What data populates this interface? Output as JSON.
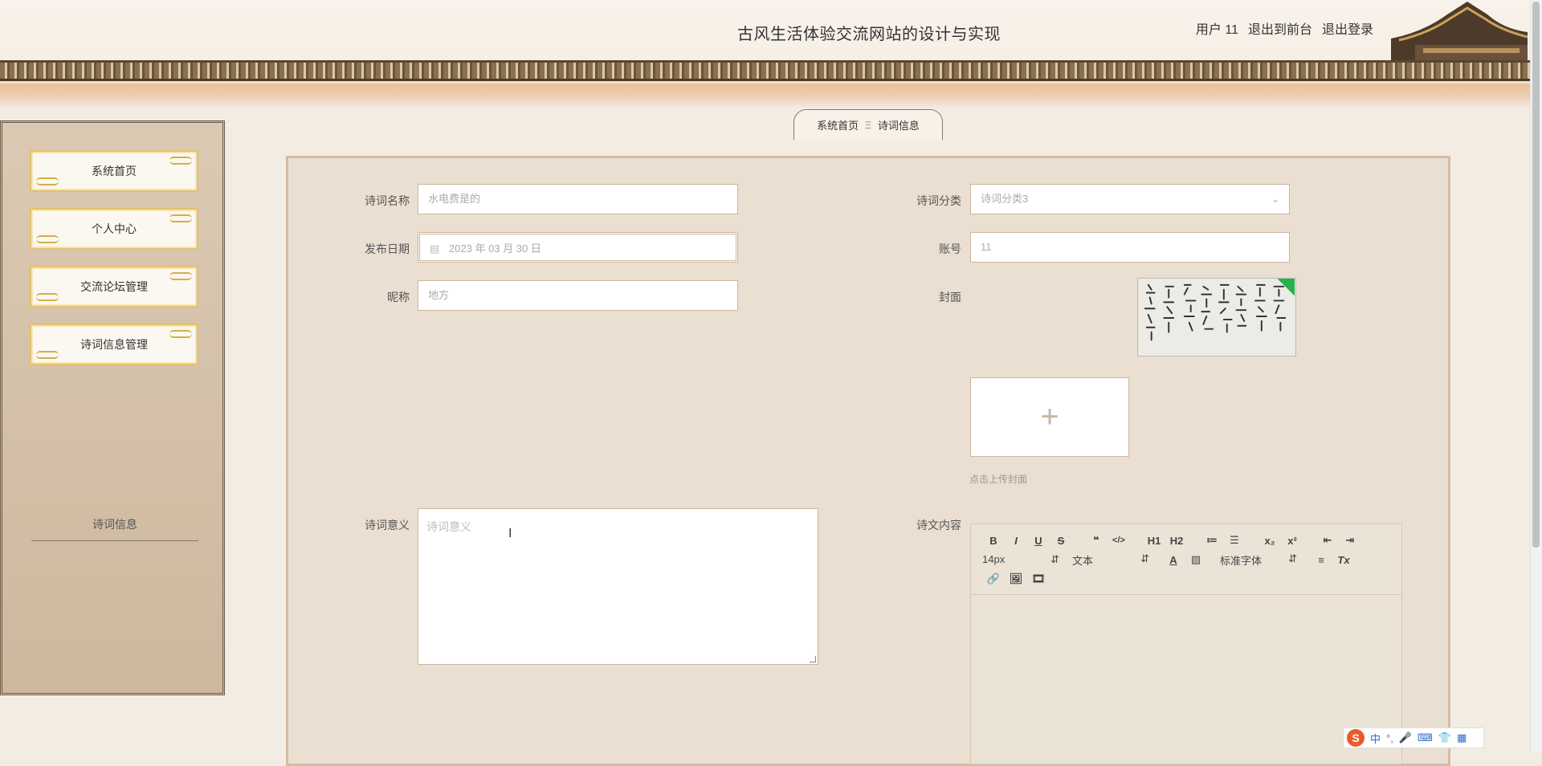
{
  "header": {
    "title": "古风生活体验交流网站的设计与实现",
    "user_label": "用户 11",
    "front_link": "退出到前台",
    "logout_link": "退出登录"
  },
  "sidebar": {
    "items": [
      {
        "label": "系统首页"
      },
      {
        "label": "个人中心"
      },
      {
        "label": "交流论坛管理"
      },
      {
        "label": "诗词信息管理"
      }
    ],
    "sub_item": "诗词信息"
  },
  "breadcrumb": {
    "home": "系统首页",
    "separator": "Ξ",
    "current": "诗词信息"
  },
  "form": {
    "poem_name": {
      "label": "诗词名称",
      "value": "水电费是的"
    },
    "category": {
      "label": "诗词分类",
      "value": "诗词分类3"
    },
    "publish_date": {
      "label": "发布日期",
      "value": "2023 年 03 月 30 日"
    },
    "account": {
      "label": "账号",
      "value": "11"
    },
    "nickname": {
      "label": "昵称",
      "value": "地方"
    },
    "cover": {
      "label": "封面",
      "upload_hint": "点击上传封面",
      "upload_symbol": "+"
    },
    "meaning": {
      "label": "诗词意义",
      "placeholder": "诗词意义"
    },
    "content": {
      "label": "诗文内容"
    }
  },
  "editor": {
    "row1": [
      "B",
      "I",
      "U",
      "S",
      "❝",
      "</>",
      "H1",
      "H2",
      "≔",
      "☰",
      "x₂",
      "x²",
      "⇤",
      "⇥"
    ],
    "font_size": "14px",
    "block_type": "文本",
    "font_family": "标准字体",
    "row2_icons": [
      "A",
      "▨",
      "≡",
      "Tx"
    ],
    "row3_icons": [
      "🔗",
      "🖼",
      "🎞"
    ]
  },
  "ime": {
    "mode": "中",
    "punct": "°,"
  },
  "colors": {
    "background": "#f3ece2",
    "panel": "#eadfd0",
    "sidebar": "#d2bea6",
    "accent_gold": "#e4c16b"
  }
}
